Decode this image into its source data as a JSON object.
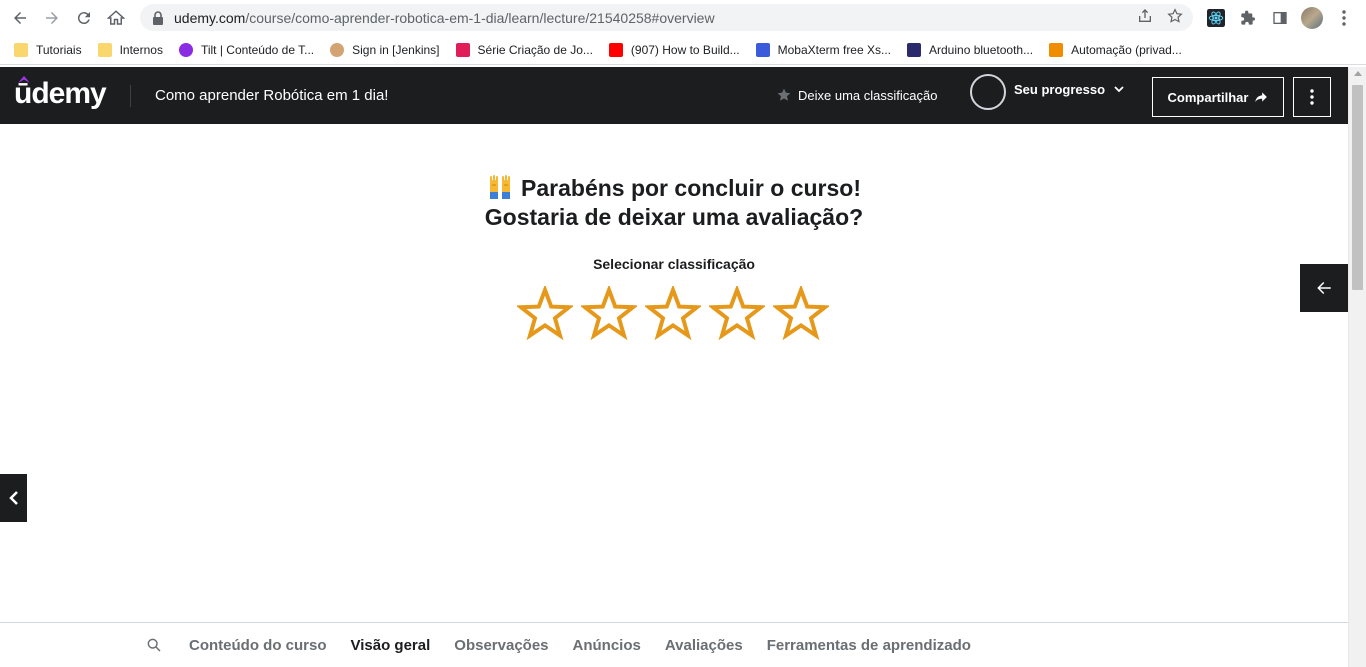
{
  "browser": {
    "url_host": "udemy.com",
    "url_path": "/course/como-aprender-robotica-em-1-dia/learn/lecture/21540258#overview"
  },
  "bookmarks": [
    {
      "label": "Tutoriais",
      "icon": "folder-icon",
      "color": "#f9d76e"
    },
    {
      "label": "Internos",
      "icon": "folder-icon",
      "color": "#f9d76e"
    },
    {
      "label": "Tilt | Conteúdo de T...",
      "icon": "tilt-icon",
      "color": "#8b2be2"
    },
    {
      "label": "Sign in [Jenkins]",
      "icon": "jenkins-icon",
      "color": "#d4a373"
    },
    {
      "label": "Série Criação de Jo...",
      "icon": "slack-icon",
      "color": "#e01e5a"
    },
    {
      "label": "(907) How to Build...",
      "icon": "youtube-icon",
      "color": "#ff0000"
    },
    {
      "label": "MobaXterm free Xs...",
      "icon": "mobaxterm-icon",
      "color": "#3b5bdb"
    },
    {
      "label": "Arduino bluetooth...",
      "icon": "arduino-icon",
      "color": "#2b2a6b"
    },
    {
      "label": "Automação (privad...",
      "icon": "automation-icon",
      "color": "#f08c00"
    }
  ],
  "header": {
    "logo": "ūdemy",
    "course_title": "Como aprender Robótica em 1 dia!",
    "rate_label": "Deixe uma classificação",
    "progress_label": "Seu progresso",
    "share_label": "Compartilhar"
  },
  "main": {
    "headline_1": "Parabéns por concluir o curso!",
    "headline_2": "Gostaria de deixar uma avaliação?",
    "select_label": "Selecionar classificação",
    "stars_total": 5,
    "stars_selected": 0,
    "star_color": "#e59819"
  },
  "tabs": [
    {
      "label": "Conteúdo do curso",
      "active": false
    },
    {
      "label": "Visão geral",
      "active": true
    },
    {
      "label": "Observações",
      "active": false
    },
    {
      "label": "Anúncios",
      "active": false
    },
    {
      "label": "Avaliações",
      "active": false
    },
    {
      "label": "Ferramentas de aprendizado",
      "active": false
    }
  ]
}
